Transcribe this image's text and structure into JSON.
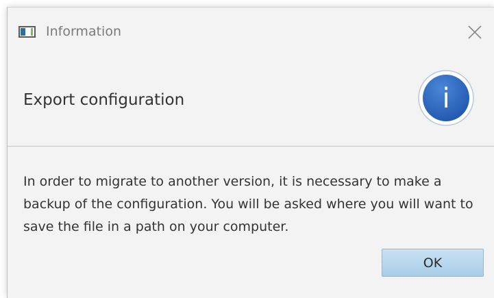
{
  "window": {
    "title": "Information",
    "icon": "java-app-icon",
    "close_icon": "close-icon"
  },
  "header": {
    "text": "Export configuration",
    "icon": "info-icon",
    "icon_glyph": "i",
    "icon_color": "#2a62b8"
  },
  "content": {
    "message": "In order to migrate to another version, it is necessary to make a backup of the configuration. You will be asked where you will want to save the file in a path on your computer."
  },
  "buttons": {
    "ok_label": "OK"
  }
}
